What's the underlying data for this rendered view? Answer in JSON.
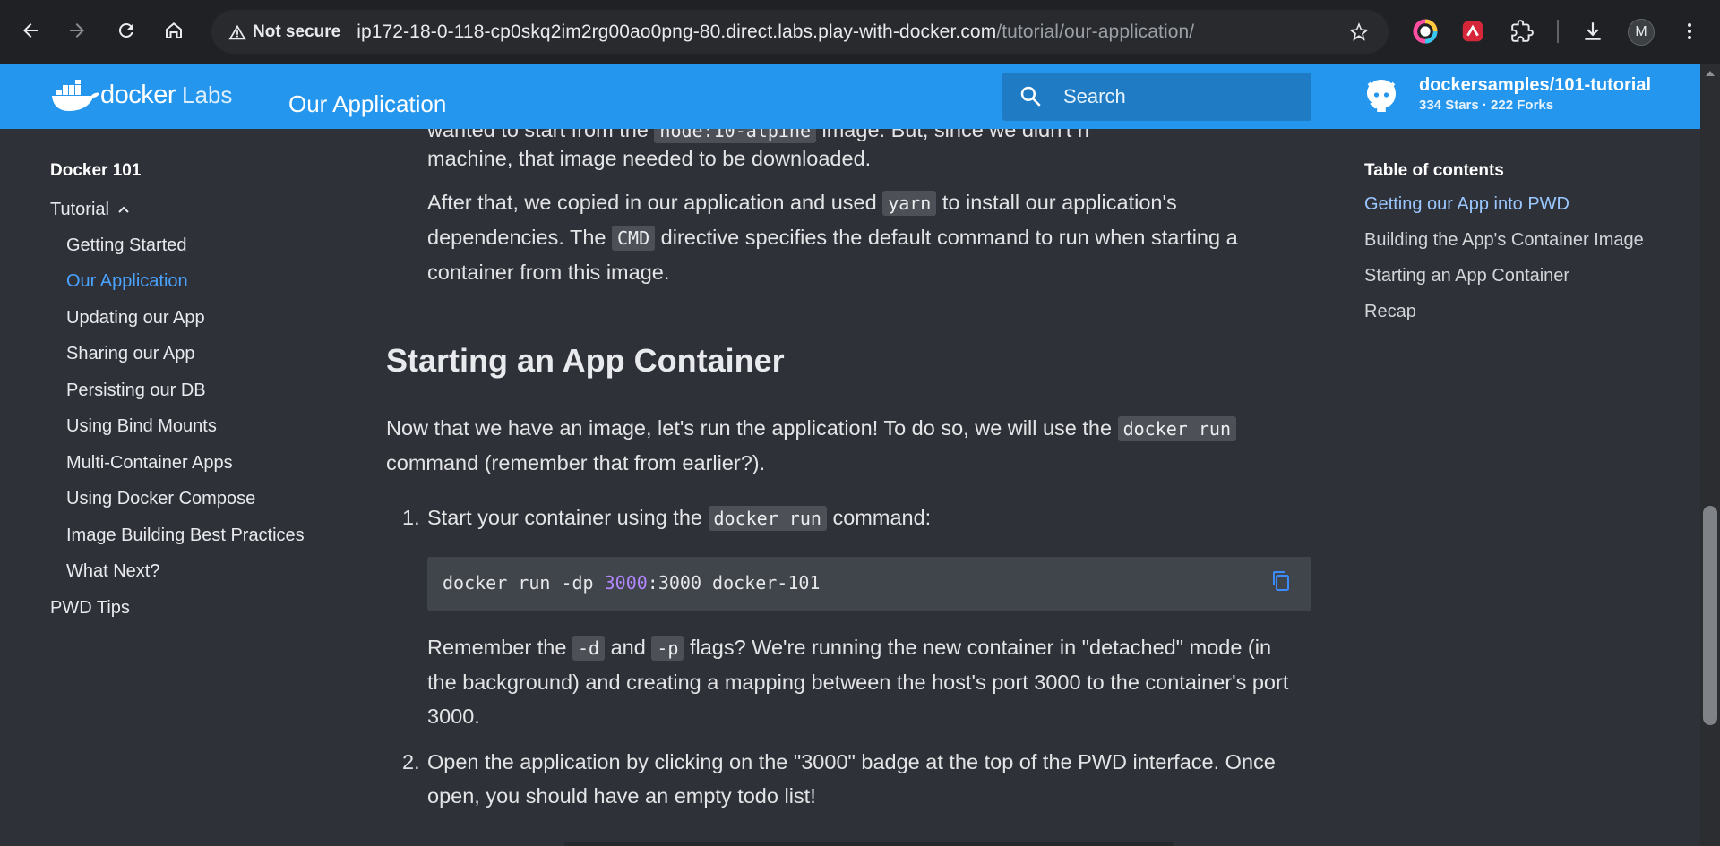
{
  "browser": {
    "security_label": "Not secure",
    "url_host": "ip172-18-0-118-cp0skq2im2rg00ao0png-80.direct.labs.play-with-docker.com",
    "url_path": "/tutorial/our-application/",
    "profile_initial": "M"
  },
  "header": {
    "logo_word": "docker",
    "logo_suffix": "Labs",
    "page_title": "Our Application",
    "search_placeholder": "Search",
    "repo_name": "dockersamples/101-tutorial",
    "repo_facts": "334 Stars · 222 Forks"
  },
  "left_nav": {
    "title": "Docker 101",
    "section": "Tutorial",
    "items": [
      {
        "label": "Getting Started"
      },
      {
        "label": "Our Application"
      },
      {
        "label": "Updating our App"
      },
      {
        "label": "Sharing our App"
      },
      {
        "label": "Persisting our DB"
      },
      {
        "label": "Using Bind Mounts"
      },
      {
        "label": "Multi-Container Apps"
      },
      {
        "label": "Using Docker Compose"
      },
      {
        "label": "Image Building Best Practices"
      },
      {
        "label": "What Next?"
      }
    ],
    "footer_item": "PWD Tips",
    "active_item": "Our Application"
  },
  "content": {
    "top_partial": {
      "before": "wanted to start from the ",
      "code": "node:10-alpine",
      "after": " image. But, since we didn't have that on our"
    },
    "para1_line2": "machine, that image needed to be downloaded.",
    "para2": {
      "t1": "After that, we copied in our application and used ",
      "code1": "yarn",
      "t2": " to install our application's",
      "t3": "dependencies. The ",
      "code2": "CMD",
      "t4": " directive specifies the default command to run when starting a",
      "t5": "container from this image."
    },
    "heading": "Starting an App Container",
    "intro": {
      "t1": "Now that we have an image, let's run the application! To do so, we will use the ",
      "code": "docker run",
      "t2": "command (remember that from earlier?)."
    },
    "step1": {
      "number": "1.",
      "t1": "Start your container using the ",
      "code": "docker run",
      "t2": " command:"
    },
    "codeblock": {
      "prefix": "docker run -dp ",
      "port": "3000",
      "suffix": ":3000 docker-101"
    },
    "step1_note": {
      "t1": "Remember the ",
      "code1": "-d",
      "t2": " and ",
      "code2": "-p",
      "t3": " flags? We're running the new container in \"detached\" mode (in",
      "t4": "the background) and creating a mapping between the host's port 3000 to the container's port",
      "t5": "3000."
    },
    "step2": {
      "number": "2.",
      "line1": "Open the application by clicking on the \"3000\" badge at the top of the PWD interface. Once",
      "line2": "open, you should have an empty todo list!"
    }
  },
  "toc": {
    "title": "Table of contents",
    "items": [
      {
        "label": "Getting our App into PWD"
      },
      {
        "label": "Building the App's Container Image"
      },
      {
        "label": "Starting an App Container"
      },
      {
        "label": "Recap"
      }
    ]
  },
  "colors": {
    "header_blue": "#2496ed",
    "page_bg": "#2e3138",
    "active_link": "#4aa3ff",
    "code_number": "#b287ff"
  }
}
